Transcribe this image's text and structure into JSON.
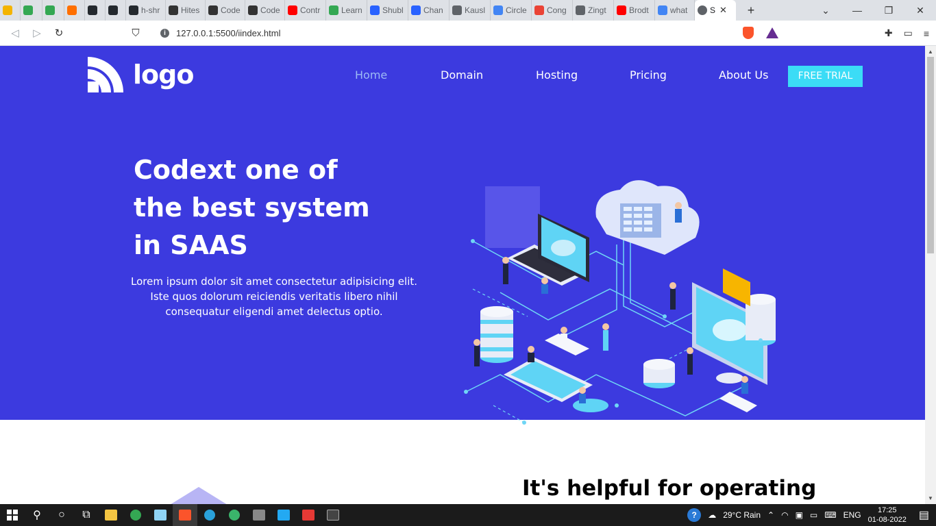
{
  "browser": {
    "tabs": [
      {
        "label": "",
        "color": "#f4b400"
      },
      {
        "label": "",
        "color": "#34a853"
      },
      {
        "label": "",
        "color": "#34a853"
      },
      {
        "label": "",
        "color": "#ff6f00"
      },
      {
        "label": "",
        "color": "#24292e"
      },
      {
        "label": "",
        "color": "#24292e"
      },
      {
        "label": "h-shr",
        "color": "#24292e"
      },
      {
        "label": "Hites",
        "color": "#333333"
      },
      {
        "label": "Code",
        "color": "#333333"
      },
      {
        "label": "Code",
        "color": "#333333"
      },
      {
        "label": "Contr",
        "color": "#ff0000"
      },
      {
        "label": "Learn",
        "color": "#34a853"
      },
      {
        "label": "Shubl",
        "color": "#2962ff"
      },
      {
        "label": "Chan",
        "color": "#2962ff"
      },
      {
        "label": "Kausl",
        "color": "#5f6368"
      },
      {
        "label": "Circle",
        "color": "#4285f4"
      },
      {
        "label": "Cong",
        "color": "#ea4335"
      },
      {
        "label": "Zingt",
        "color": "#5f6368"
      },
      {
        "label": "Brodt",
        "color": "#ff0000"
      },
      {
        "label": "what",
        "color": "#4285f4"
      }
    ],
    "active_tab": {
      "label": "S",
      "close": "✕"
    },
    "new_tab": "+",
    "window_controls": {
      "menu": "⌄",
      "minimize": "—",
      "restore": "❐",
      "close": "✕"
    },
    "address": "127.0.0.1:5500/iindex.html"
  },
  "site": {
    "logo_text": "logo",
    "nav": {
      "home": "Home",
      "domain": "Domain",
      "hosting": "Hosting",
      "pricing": "Pricing",
      "about": "About Us",
      "trial": "FREE TRIAL"
    },
    "headline": {
      "line1": "Codext one of",
      "line2": "the best system",
      "line3": "in SAAS"
    },
    "subtext": "Lorem ipsum dolor sit amet consectetur adipisicing elit. Iste quos dolorum reiciendis veritatis libero nihil consequatur eligendi amet delectus optio.",
    "section_heading": "It's helpful for operating"
  },
  "colors": {
    "hero_bg": "#3c3adf",
    "accent": "#3bdcf6",
    "nav_active": "#9dbbf5"
  },
  "taskbar": {
    "weather": "29°C  Rain",
    "language": "ENG",
    "time": "17:25",
    "date": "01-08-2022"
  }
}
